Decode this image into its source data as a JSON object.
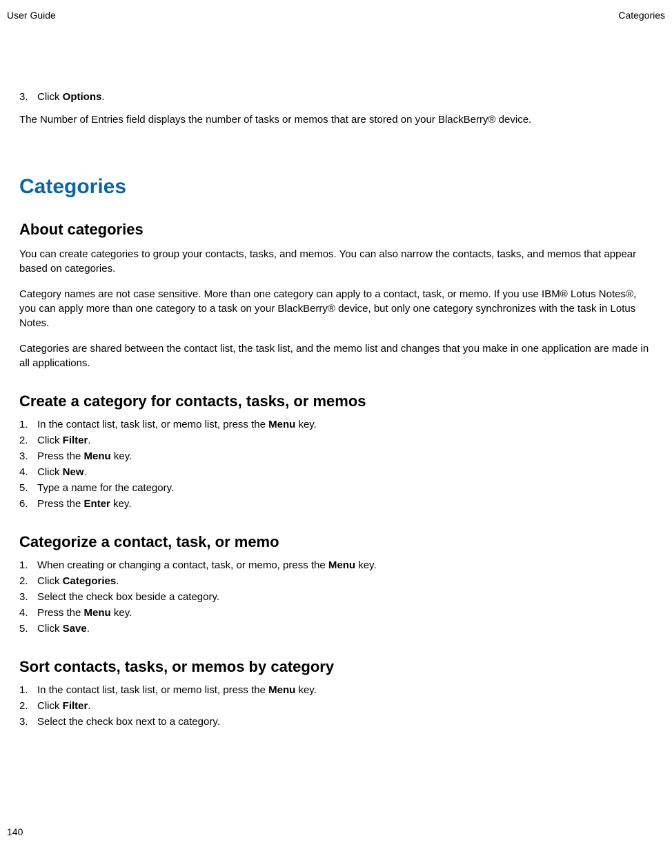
{
  "header": {
    "left": "User Guide",
    "right": "Categories"
  },
  "top_step": {
    "num": "3.",
    "pre": "Click ",
    "bold": "Options",
    "post": "."
  },
  "top_para": "The Number of Entries field displays the number of tasks or memos that are stored on your BlackBerry® device.",
  "h1": "Categories",
  "about": {
    "heading": "About categories",
    "p1": "You can create categories to group your contacts, tasks, and memos. You can also narrow the contacts, tasks, and memos that appear based on categories.",
    "p2": "Category names are not case sensitive. More than one category can apply to a contact, task, or memo. If you use IBM® Lotus Notes®, you can apply more than one category to a task on your BlackBerry® device, but only one category synchronizes with the task in Lotus Notes.",
    "p3": "Categories are shared between the contact list, the task list, and the memo list and changes that you make in one application are made in all applications."
  },
  "create": {
    "heading": "Create a category for contacts, tasks, or memos",
    "steps": [
      {
        "num": "1.",
        "pre": "In the contact list, task list, or memo list, press the ",
        "bold": "Menu",
        "post": " key."
      },
      {
        "num": "2.",
        "pre": "Click ",
        "bold": "Filter",
        "post": "."
      },
      {
        "num": "3.",
        "pre": "Press the ",
        "bold": "Menu",
        "post": " key."
      },
      {
        "num": "4.",
        "pre": "Click ",
        "bold": "New",
        "post": "."
      },
      {
        "num": "5.",
        "pre": "Type a name for the category.",
        "bold": "",
        "post": ""
      },
      {
        "num": "6.",
        "pre": "Press the ",
        "bold": "Enter",
        "post": " key."
      }
    ]
  },
  "categorize": {
    "heading": "Categorize a contact, task, or memo",
    "steps": [
      {
        "num": "1.",
        "pre": "When creating or changing a contact, task, or memo, press the ",
        "bold": "Menu",
        "post": " key."
      },
      {
        "num": "2.",
        "pre": "Click ",
        "bold": "Categories",
        "post": "."
      },
      {
        "num": "3.",
        "pre": "Select the check box beside a category.",
        "bold": "",
        "post": ""
      },
      {
        "num": "4.",
        "pre": "Press the ",
        "bold": "Menu",
        "post": " key."
      },
      {
        "num": "5.",
        "pre": "Click ",
        "bold": "Save",
        "post": "."
      }
    ]
  },
  "sort": {
    "heading": "Sort contacts, tasks, or memos by category",
    "steps": [
      {
        "num": "1.",
        "pre": "In the contact list, task list, or memo list, press the ",
        "bold": "Menu",
        "post": " key."
      },
      {
        "num": "2.",
        "pre": "Click ",
        "bold": "Filter",
        "post": "."
      },
      {
        "num": "3.",
        "pre": "Select the check box next to a category.",
        "bold": "",
        "post": ""
      }
    ]
  },
  "page_number": "140"
}
